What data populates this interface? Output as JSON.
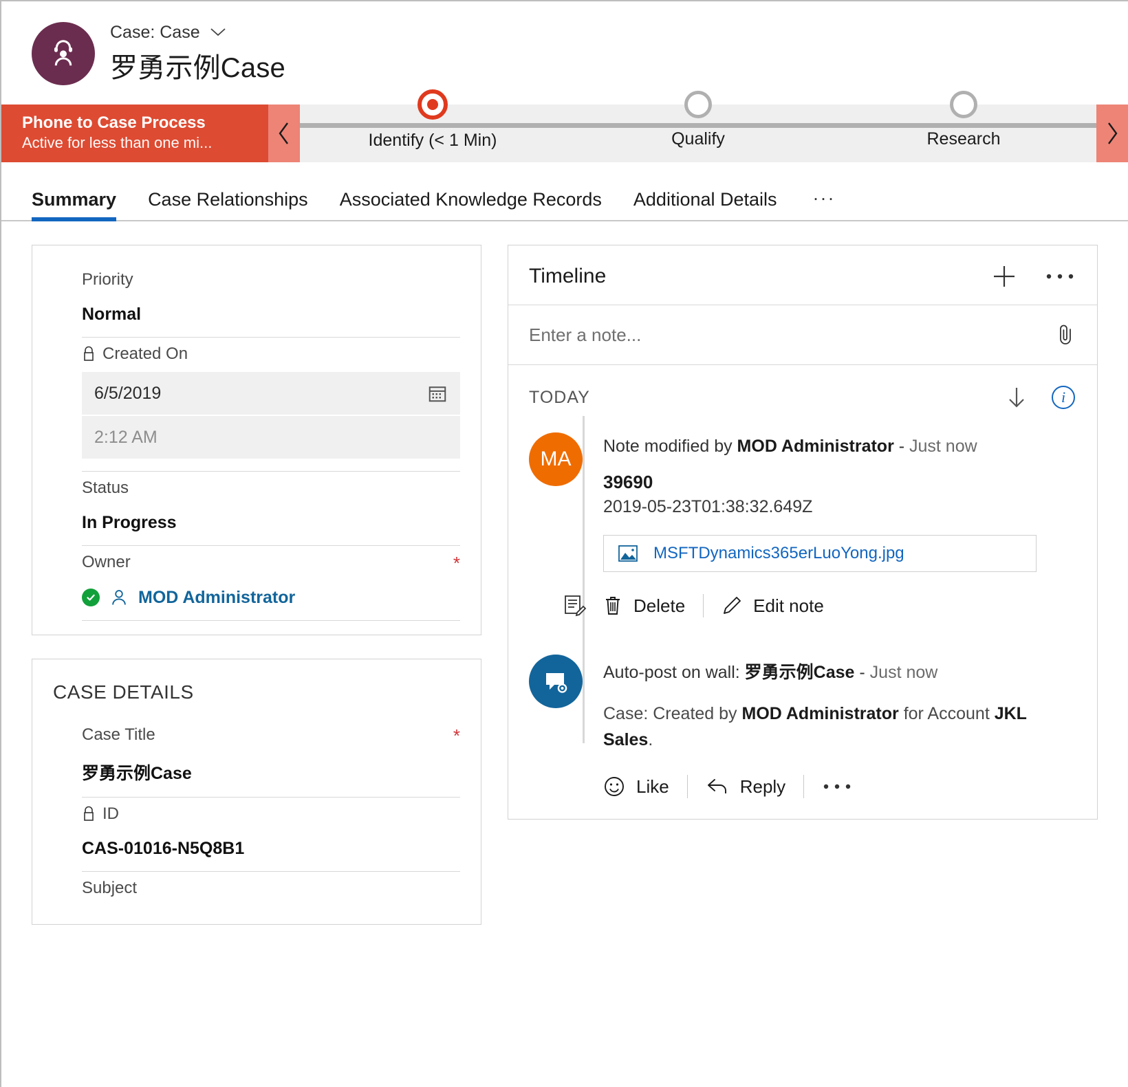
{
  "header": {
    "entity_label": "Case: Case",
    "record_title": "罗勇示例Case",
    "avatar_icon": "case-agent-icon",
    "chevron_icon": "chevron-down-icon"
  },
  "process": {
    "name": "Phone to Case Process",
    "subtitle": "Active for less than one mi...",
    "prev_icon": "chevron-left-icon",
    "next_icon": "chevron-right-icon",
    "active_color": "#e03a1e",
    "banner_color": "#dd4b32",
    "stages": [
      {
        "label": "Identify  (< 1 Min)",
        "state": "active"
      },
      {
        "label": "Qualify",
        "state": "inactive"
      },
      {
        "label": "Research",
        "state": "inactive"
      }
    ]
  },
  "tabs": {
    "items": [
      {
        "label": "Summary",
        "active": true
      },
      {
        "label": "Case Relationships",
        "active": false
      },
      {
        "label": "Associated Knowledge Records",
        "active": false
      },
      {
        "label": "Additional Details",
        "active": false
      }
    ],
    "more_label": "···",
    "active_underline_color": "#1266c0"
  },
  "summary_card": {
    "priority": {
      "label": "Priority",
      "value": "Normal"
    },
    "created_on": {
      "label": "Created On",
      "lock_icon": "lock-icon",
      "date_value": "6/5/2019",
      "time_value": "2:12 AM",
      "calendar_icon": "calendar-icon"
    },
    "status": {
      "label": "Status",
      "value": "In Progress"
    },
    "owner": {
      "label": "Owner",
      "required": "*",
      "value": "MOD Administrator",
      "check_icon": "check-circle-icon",
      "person_icon": "person-icon",
      "link_color": "#12659b"
    }
  },
  "case_details": {
    "section_title": "CASE DETAILS",
    "case_title": {
      "label": "Case Title",
      "required": "*",
      "value": "罗勇示例Case"
    },
    "id": {
      "label": "ID",
      "lock_icon": "lock-icon",
      "value": "CAS-01016-N5Q8B1"
    },
    "subject": {
      "label": "Subject"
    }
  },
  "timeline": {
    "title": "Timeline",
    "add_icon": "plus-icon",
    "more_icon": "ellipsis-icon",
    "note_placeholder": "Enter a note...",
    "attach_icon": "paperclip-icon",
    "group_label": "TODAY",
    "sort_icon": "arrow-down-icon",
    "info_icon": "info-icon",
    "entries": [
      {
        "avatar_initials": "MA",
        "avatar_color": "#ef6c00",
        "badge_icon": "note-edit-icon",
        "header_prefix": "Note modified by ",
        "header_actor": "MOD Administrator",
        "header_dash": " - ",
        "header_time": "Just now",
        "title": "39690",
        "subtitle": "2019-05-23T01:38:32.649Z",
        "attachment": {
          "name": "MSFTDynamics365erLuoYong.jpg",
          "icon": "image-icon"
        },
        "actions": [
          {
            "label": "Delete",
            "icon": "trash-icon"
          },
          {
            "label": "Edit note",
            "icon": "pencil-icon"
          }
        ]
      },
      {
        "avatar_initials": "",
        "avatar_color": "#12659b",
        "badge_icon": "post-gear-icon",
        "header_prefix": "Auto-post on wall: ",
        "header_actor": "罗勇示例Case",
        "header_dash": " - ",
        "header_time": "Just now",
        "post_prefix": "Case: Created by ",
        "post_actor": "MOD Administrator",
        "post_middle": " for Account ",
        "post_account": "JKL Sales",
        "post_suffix": ".",
        "actions": [
          {
            "label": "Like",
            "icon": "smiley-icon"
          },
          {
            "label": "Reply",
            "icon": "reply-arrow-icon"
          },
          {
            "label": "···",
            "icon": "ellipsis-icon"
          }
        ]
      }
    ]
  }
}
